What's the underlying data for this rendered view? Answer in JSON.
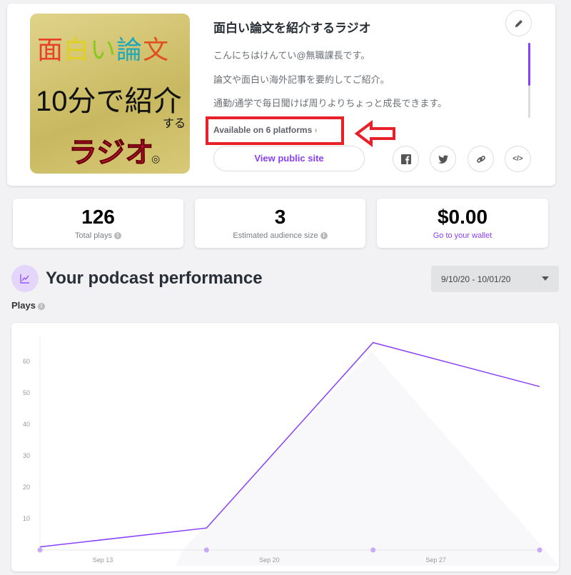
{
  "podcast": {
    "cover_art_text": [
      "面白い論文",
      "10分で紹介",
      "する",
      "ラジオ",
      "◎"
    ],
    "title": "面白い論文を紹介するラジオ",
    "description": [
      "こんにちはけんてい@無職課長です。",
      "論文や面白い海外記事を要約してご紹介。",
      "通勤/通学で毎日聞けば周りよりちょっと成長できます。"
    ],
    "platforms_link": "Available on 6 platforms",
    "view_public_site": "View public site",
    "share_icons": [
      "facebook-icon",
      "twitter-icon",
      "link-icon",
      "embed-code-icon"
    ],
    "edit_icon": "pencil-icon"
  },
  "stats": [
    {
      "value": "126",
      "label": "Total plays",
      "info": "i"
    },
    {
      "value": "3",
      "label": "Estimated audience size",
      "info": "i"
    },
    {
      "value": "$0.00",
      "label": "Go to your wallet"
    }
  ],
  "performance": {
    "title": "Your podcast performance",
    "date_range": "9/10/20 - 10/01/20",
    "plays_label": "Plays"
  },
  "colors": {
    "accent": "#8940fa",
    "annotation": "#e8202a"
  },
  "chart_data": {
    "type": "line",
    "x": [
      "Sep 10",
      "Sep 17",
      "Sep 24",
      "Oct 1"
    ],
    "values": [
      1,
      7,
      66,
      52
    ],
    "x_tick_labels": [
      "Sep 13",
      "Sep 20",
      "Sep 27"
    ],
    "y_ticks": [
      10,
      20,
      30,
      40,
      50,
      60
    ],
    "ylim": [
      0,
      70
    ],
    "grid": false,
    "color": "#8940fa"
  }
}
